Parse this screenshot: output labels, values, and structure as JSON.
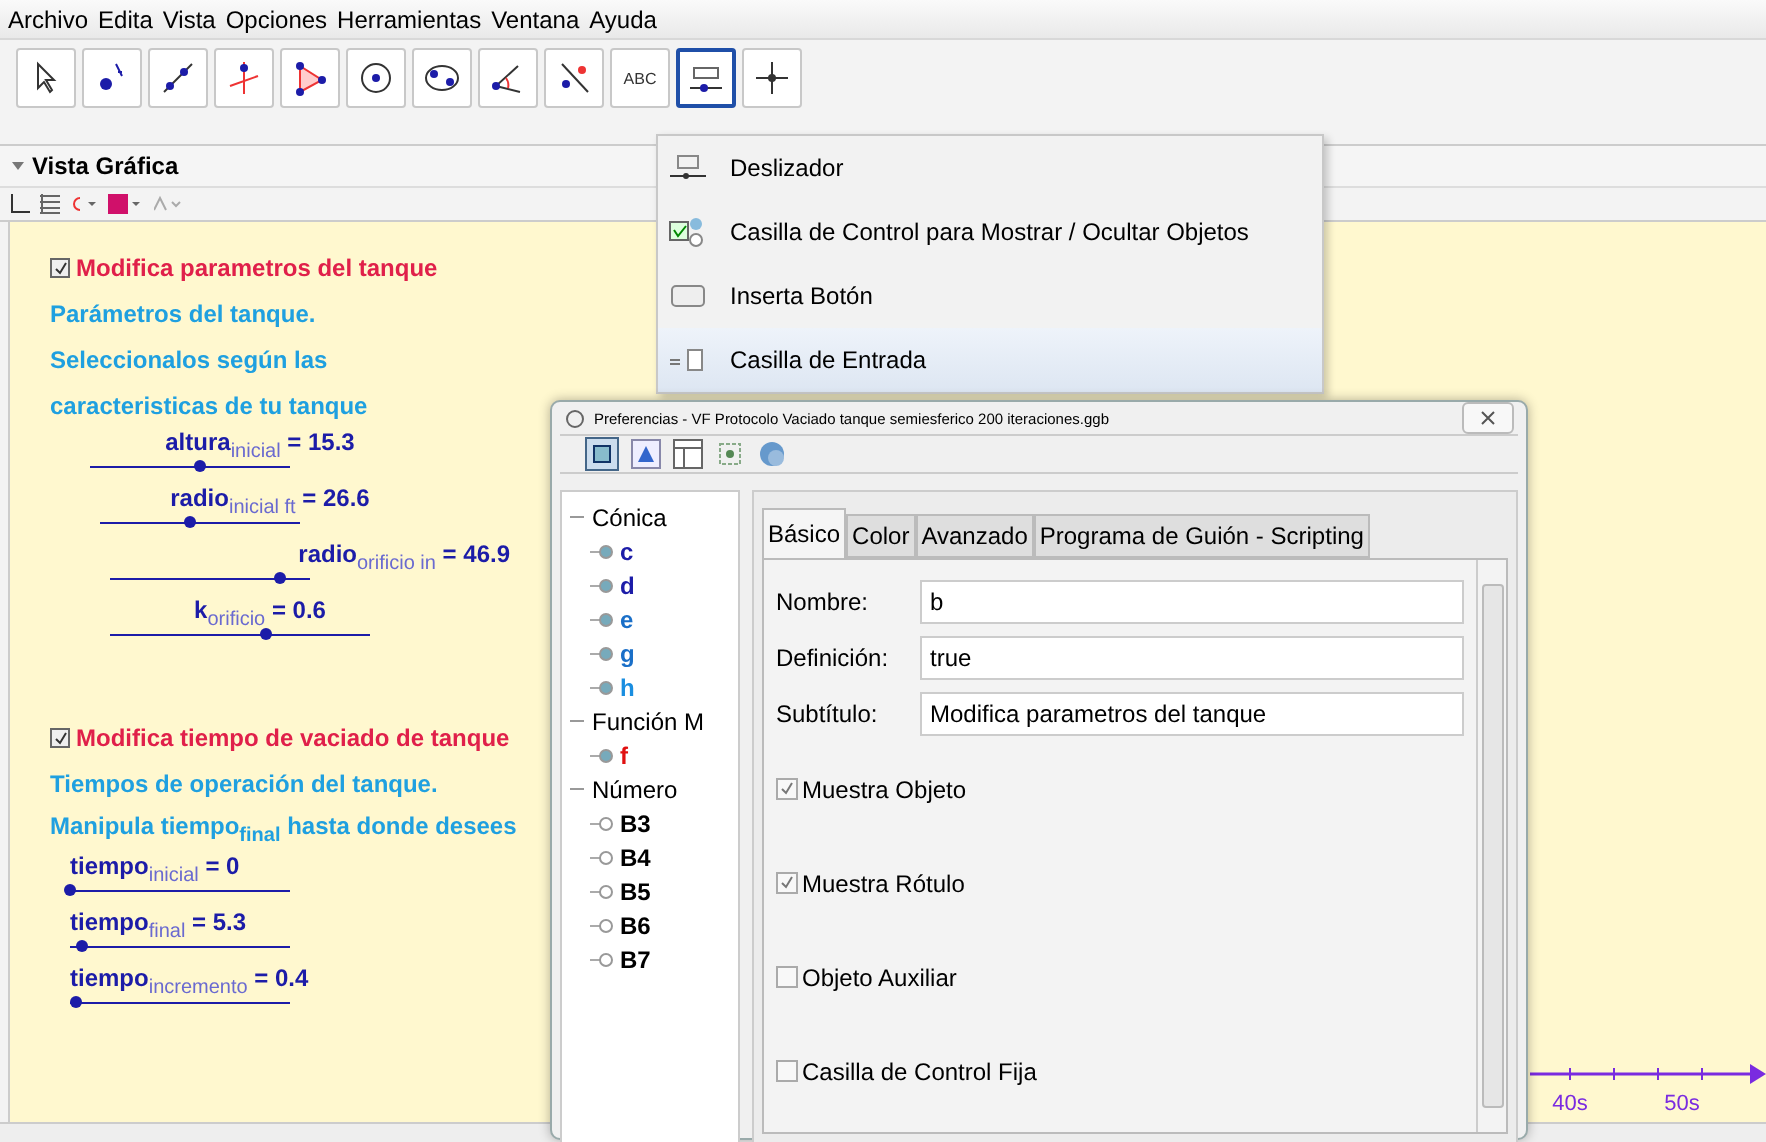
{
  "menu_bar": [
    "Archivo",
    "Edita",
    "Vista",
    "Opciones",
    "Herramientas",
    "Ventana",
    "Ayuda"
  ],
  "toolbar": [
    {
      "kind": "pointer",
      "selected": false
    },
    {
      "kind": "point",
      "selected": false
    },
    {
      "kind": "line",
      "selected": false
    },
    {
      "kind": "perpendicular",
      "selected": false
    },
    {
      "kind": "polygon",
      "selected": false
    },
    {
      "kind": "circle",
      "selected": false
    },
    {
      "kind": "ellipse",
      "selected": false
    },
    {
      "kind": "angle",
      "selected": false
    },
    {
      "kind": "reflect",
      "selected": false
    },
    {
      "kind": "text",
      "label": "ABC",
      "selected": false
    },
    {
      "kind": "slider",
      "selected": true
    },
    {
      "kind": "move",
      "selected": false
    }
  ],
  "tool_menu": [
    {
      "kind": "slider",
      "label": "Deslizador",
      "selected": false
    },
    {
      "kind": "checkbox",
      "label": "Casilla de Control para Mostrar / Ocultar Objetos",
      "selected": false
    },
    {
      "kind": "button",
      "label": "Inserta Botón",
      "selected": false
    },
    {
      "kind": "input",
      "label": "Casilla de Entrada",
      "selected": true
    }
  ],
  "graphics_view": {
    "title": "Vista Gráfica",
    "groups": [
      {
        "checkbox": {
          "label": "Modifica parametros del tanque",
          "checked": true
        },
        "texts": [
          "Parámetros del tanque.",
          "Seleccionalos según las",
          "caracteristicas de tu tanque"
        ],
        "sliders": [
          {
            "label": "altura$_{inicial}$ = 15.3",
            "level": 0.55
          },
          {
            "label": "radio$_{inicial ft}$ = 26.6",
            "level": 0.45
          },
          {
            "label": "radio$_{orificio in}$ = 46.9",
            "level": 0.85
          },
          {
            "label": "k$_{orificio}$ = 0.6",
            "level": 0.6
          }
        ]
      },
      {
        "checkbox": {
          "label": "Modifica tiempo de vaciado de tanque",
          "checked": true
        },
        "texts": [
          "Tiempos de operación del tanque.",
          "Manipula tiempo$_{final}$ hasta donde desees"
        ],
        "sliders": [
          {
            "label": "tiempo$_{inicial}$ = 0",
            "level": 0
          },
          {
            "label": "tiempo$_{final}$ = 5.3",
            "level": 0.05
          },
          {
            "label": "tiempo$_{incremento}$ = 0.4",
            "level": 0.03
          }
        ]
      }
    ],
    "axis_ticks": [
      "40s",
      "50s"
    ]
  },
  "preferences": {
    "title": "Preferencias - VF Protocolo Vaciado tanque semiesferico 200 iteraciones.ggb",
    "tree": [
      {
        "label": "Cónica",
        "expanded": true,
        "children": [
          {
            "label": "c",
            "color": "#1c1ca8"
          },
          {
            "label": "d",
            "color": "#1c1ca8"
          },
          {
            "label": "e",
            "color": "#1a6fc8"
          },
          {
            "label": "g",
            "color": "#1a6fc8"
          },
          {
            "label": "h",
            "color": "#1a8ee0"
          }
        ]
      },
      {
        "label": "Función M",
        "expanded": true,
        "children": [
          {
            "label": "f",
            "color": "#e01010"
          }
        ]
      },
      {
        "label": "Número",
        "expanded": true,
        "children": [
          {
            "label": "B3",
            "color": "#000000"
          },
          {
            "label": "B4",
            "color": "#000000"
          },
          {
            "label": "B5",
            "color": "#000000"
          },
          {
            "label": "B6",
            "color": "#000000"
          },
          {
            "label": "B7",
            "color": "#000000"
          }
        ]
      }
    ],
    "tabs": [
      {
        "label": "Básico",
        "selected": true
      },
      {
        "label": "Color",
        "selected": false
      },
      {
        "label": "Avanzado",
        "selected": false
      },
      {
        "label": "Programa de Guión - Scripting",
        "selected": false
      }
    ],
    "fields": [
      {
        "label": "Nombre:",
        "value": "b"
      },
      {
        "label": "Definición:",
        "value": "true"
      },
      {
        "label": "Subtítulo:",
        "value": "Modifica parametros del tanque"
      }
    ],
    "options": [
      {
        "label": "Muestra Objeto",
        "checked": true
      },
      {
        "label": "Muestra Rótulo",
        "checked": true
      },
      {
        "label": "Objeto Auxiliar",
        "checked": false
      },
      {
        "label": "Casilla de Control Fija",
        "checked": false
      }
    ]
  }
}
